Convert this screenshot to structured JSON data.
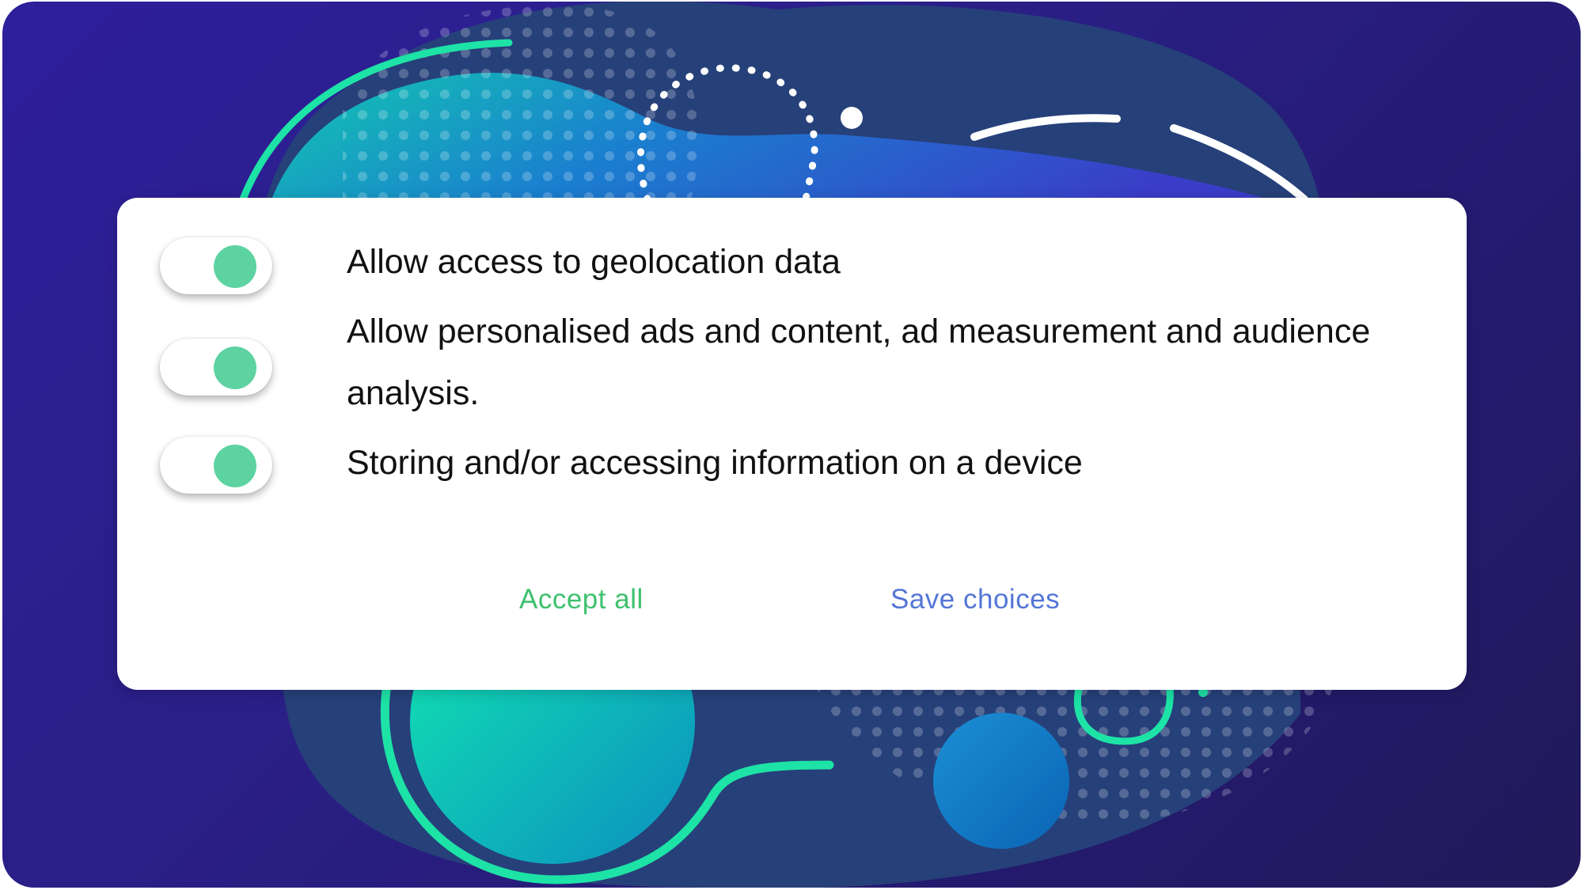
{
  "consent_dialog": {
    "options": [
      {
        "label": "Allow access to geolocation data",
        "enabled": true
      },
      {
        "label": "Allow personalised ads and content, ad measurement and audience analysis.",
        "enabled": true
      },
      {
        "label": "Storing and/or accessing information on a device",
        "enabled": true
      }
    ],
    "accept_all_label": "Accept all",
    "save_choices_label": "Save choices"
  },
  "colors": {
    "toggle_on": "#5ed3a2",
    "accept_all": "#3fc16f",
    "save_choices": "#5477d6",
    "background": "#2a1f86",
    "accent_teal": "#1de3a6"
  }
}
